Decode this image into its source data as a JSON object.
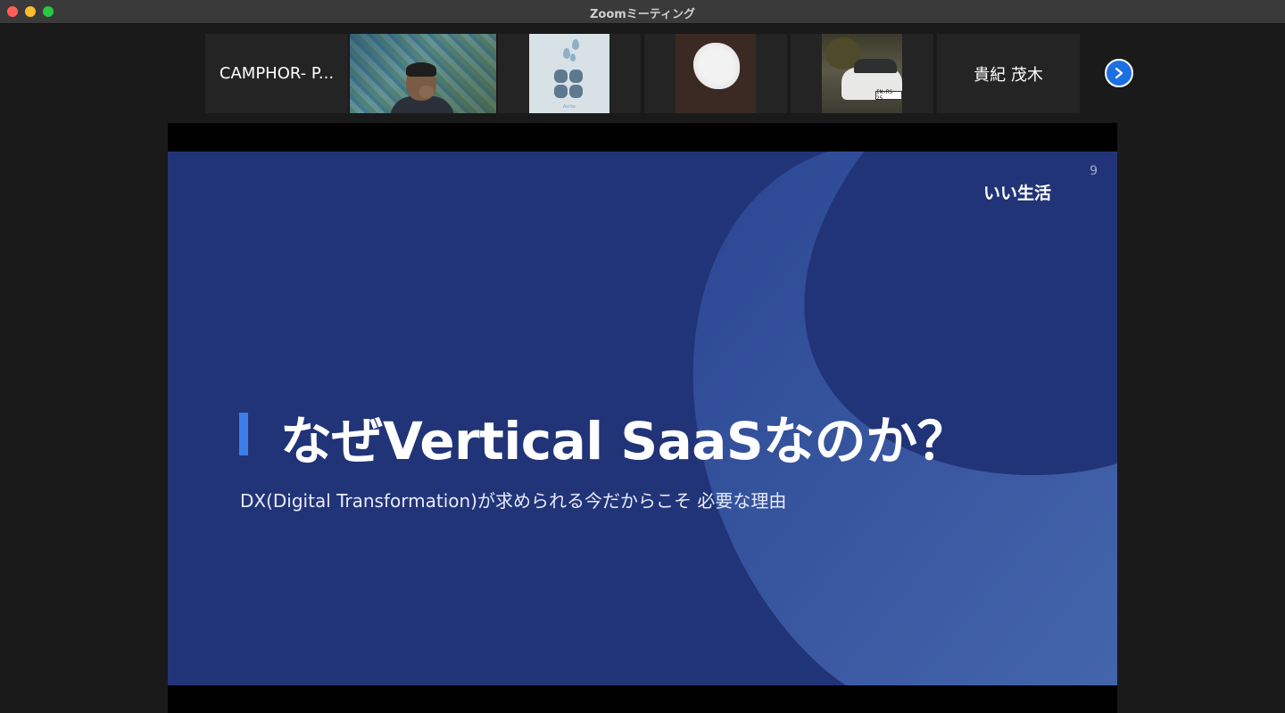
{
  "window": {
    "title": "Zoomミーティング"
  },
  "participants": [
    {
      "name": "CAMPHOR- P..."
    },
    {
      "name": ""
    },
    {
      "name": ""
    },
    {
      "name": ""
    },
    {
      "name": ""
    },
    {
      "name": "貴紀 茂木"
    }
  ],
  "logo_tile": {
    "caption": "Aorke"
  },
  "car_tile": {
    "plate": "IN-RS 25"
  },
  "slide": {
    "page_number": "9",
    "brand": "いい生活",
    "title": "なぜVertical SaaSなのか？",
    "subtitle": "DX(Digital Transformation)が求められる今だからこそ 必要な理由"
  },
  "colors": {
    "slide_bg": "#223478",
    "slide_curve": "#3a5ba8",
    "accent_bar": "#3c7ee6",
    "active_speaker_border": "#c8e35c",
    "next_button": "#1c6fe0"
  }
}
